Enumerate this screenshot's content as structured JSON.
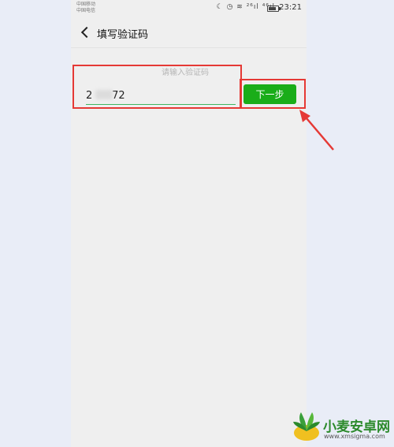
{
  "status_bar": {
    "carrier_1": "中国移动",
    "carrier_2": "中国电信",
    "icons": "☾ ◷ ≋ ²⁶ıl ⁴⁶ıl",
    "time": "23:21"
  },
  "nav": {
    "title": "填写验证码"
  },
  "form": {
    "placeholder": "请输入验证码",
    "value": "2      72",
    "next_label": "下一步"
  },
  "colors": {
    "accent": "#1aad19",
    "annotation": "#e53935",
    "background": "#efefef"
  },
  "watermark": {
    "text": "小麦安卓网",
    "url": "www.xmsigma.com"
  }
}
